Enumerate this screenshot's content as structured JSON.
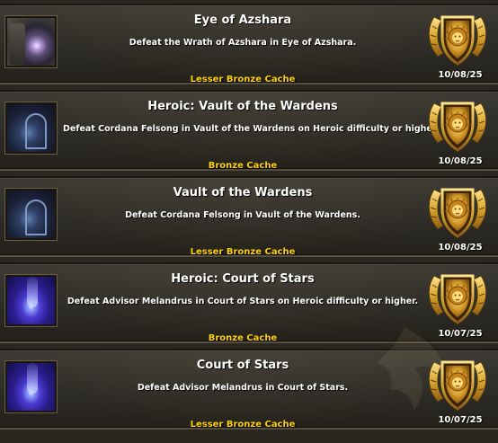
{
  "achievements": [
    {
      "title": "Eye of Azshara",
      "description": "Defeat the Wrath of Azshara in Eye of Azshara.",
      "reward": "Lesser Bronze Cache",
      "date": "10/08/25",
      "icon": "eye-of-azshara-icon"
    },
    {
      "title": "Heroic: Vault of the Wardens",
      "description": "Defeat Cordana Felsong in Vault of the Wardens on Heroic difficulty or higher.",
      "reward": "Bronze Cache",
      "date": "10/08/25",
      "icon": "vault-of-the-wardens-icon"
    },
    {
      "title": "Vault of the Wardens",
      "description": "Defeat Cordana Felsong in Vault of the Wardens.",
      "reward": "Lesser Bronze Cache",
      "date": "10/08/25",
      "icon": "vault-of-the-wardens-icon"
    },
    {
      "title": "Heroic: Court of Stars",
      "description": "Defeat Advisor Melandrus in Court of Stars on Heroic difficulty or higher.",
      "reward": "Bronze Cache",
      "date": "10/07/25",
      "icon": "court-of-stars-icon"
    },
    {
      "title": "Court of Stars",
      "description": "Defeat Advisor Melandrus in Court of Stars.",
      "reward": "Lesser Bronze Cache",
      "date": "10/07/25",
      "icon": "court-of-stars-icon"
    }
  ],
  "colors": {
    "title": "#ffffff",
    "reward": "#ffd100",
    "shield_gold": "#d9a62e",
    "row_border": "#57503f"
  },
  "badge_icon": "gold-lion-shield-icon"
}
